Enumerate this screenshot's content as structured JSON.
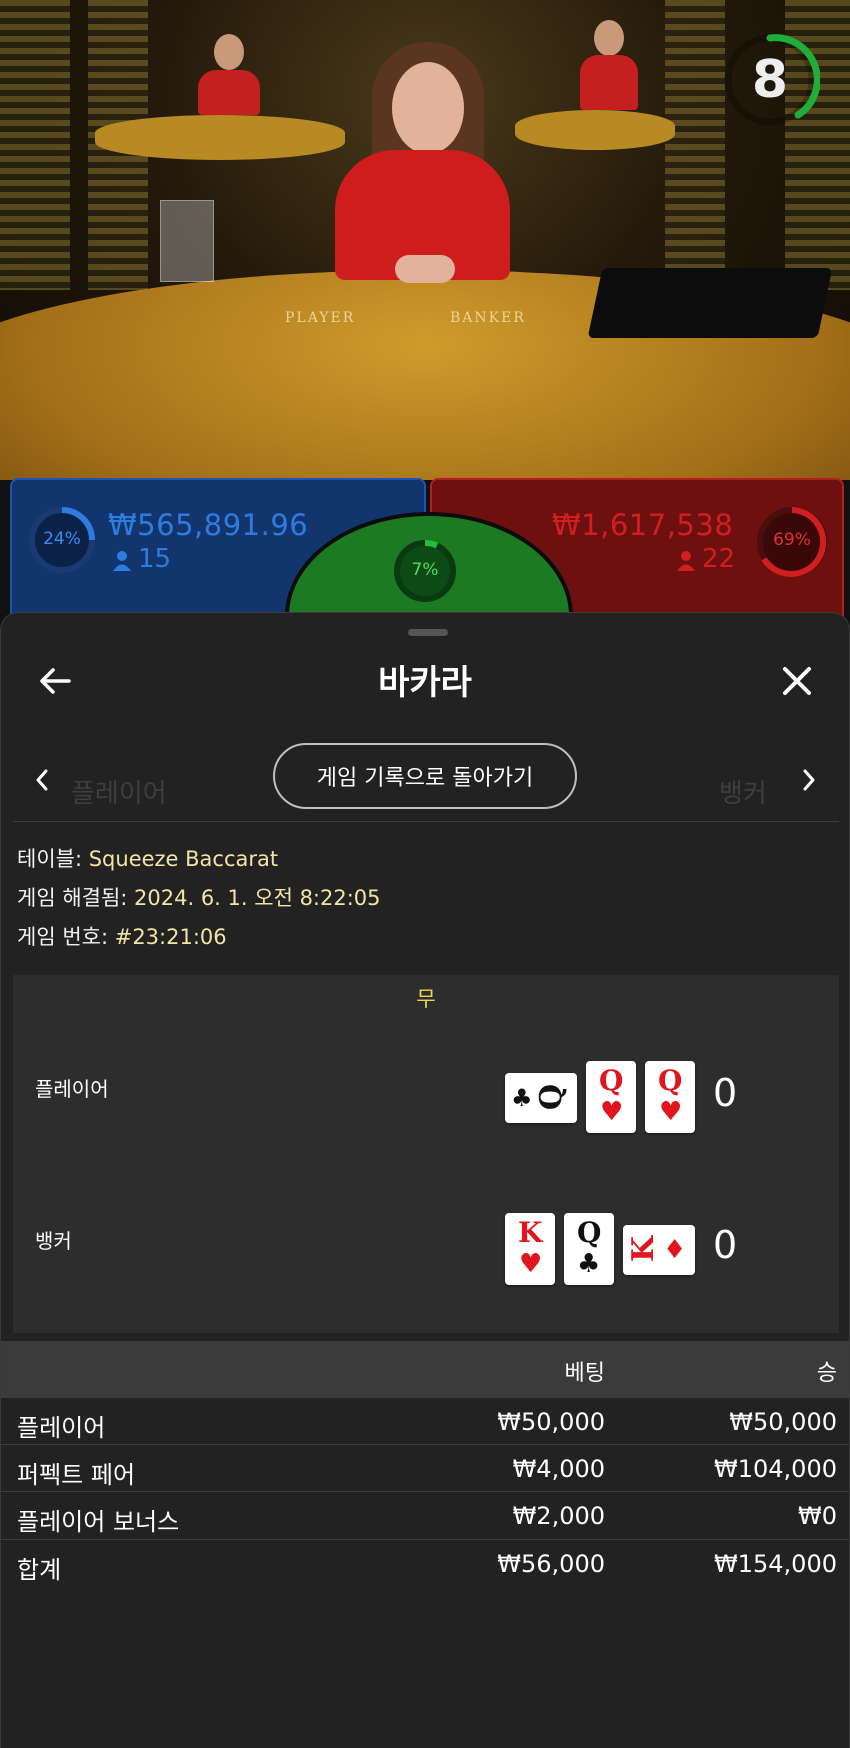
{
  "video": {
    "countdown": "8",
    "table_labels": {
      "player": "PLAYER",
      "banker": "BANKER"
    }
  },
  "bets": {
    "player": {
      "percent": "24%",
      "amount": "₩565,891.96",
      "count": "15",
      "color": "#2f7ce0"
    },
    "tie": {
      "percent": "7%"
    },
    "banker": {
      "percent": "69%",
      "amount": "₩1,617,538",
      "count": "22",
      "color": "#d11f1f"
    }
  },
  "sheet": {
    "title": "바카라",
    "back_icon": "arrow-left-icon",
    "close_icon": "close-icon",
    "history_button": "게임 기록으로 돌아가기",
    "info": [
      {
        "label": "테이블: ",
        "value": "Squeeze Baccarat"
      },
      {
        "label": "게임 해결됨: ",
        "value": "2024. 6. 1. 오전 8:22:05"
      },
      {
        "label": "게임 번호: ",
        "value": "#23:21:06"
      }
    ],
    "outcome": "무",
    "hands": {
      "player": {
        "label": "플레이어",
        "score": "0",
        "cards": [
          {
            "rank": "Q",
            "suit": "♣",
            "color": "black",
            "rotated": true
          },
          {
            "rank": "Q",
            "suit": "♥",
            "color": "red",
            "rotated": false
          },
          {
            "rank": "Q",
            "suit": "♥",
            "color": "red",
            "rotated": false
          }
        ]
      },
      "banker": {
        "label": "뱅커",
        "score": "0",
        "cards": [
          {
            "rank": "K",
            "suit": "♥",
            "color": "red",
            "rotated": false
          },
          {
            "rank": "Q",
            "suit": "♣",
            "color": "black",
            "rotated": false
          },
          {
            "rank": "K",
            "suit": "♦",
            "color": "red",
            "rotated": true
          }
        ]
      }
    },
    "bets_table": {
      "columns": {
        "bet": "베팅",
        "win": "승"
      },
      "rows": [
        {
          "name": "플레이어",
          "bet": "₩50,000",
          "win": "₩50,000"
        },
        {
          "name": "퍼펙트 페어",
          "bet": "₩4,000",
          "win": "₩104,000"
        },
        {
          "name": "플레이어 보너스",
          "bet": "₩2,000",
          "win": "₩0"
        }
      ],
      "total": {
        "name": "합계",
        "bet": "₩56,000",
        "win": "₩154,000"
      }
    }
  }
}
